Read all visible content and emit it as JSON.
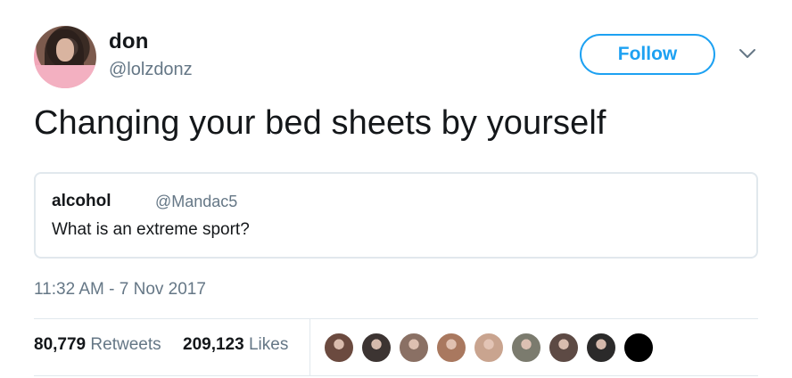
{
  "author": {
    "display_name": "don",
    "handle": "@lolzdonz",
    "avatar_icon": "profile-photo-avatar"
  },
  "follow": {
    "label": "Follow",
    "color": "#1da1f2"
  },
  "menu_icon": "chevron-down-icon",
  "tweet": {
    "text": "Changing your bed sheets by yourself"
  },
  "quoted_tweet": {
    "display_name": "alcohol",
    "handle": "@Mandac5",
    "text": "What is an extreme sport?"
  },
  "timestamp": "11:32 AM - 7 Nov 2017",
  "stats": {
    "retweets": {
      "count": "80,779",
      "label": "Retweets"
    },
    "likes": {
      "count": "209,123",
      "label": "Likes"
    }
  },
  "likers": [
    {
      "name": "liker-avatar-1",
      "color": "#6b4a3f"
    },
    {
      "name": "liker-avatar-2",
      "color": "#3c3432"
    },
    {
      "name": "liker-avatar-3",
      "color": "#8a7064"
    },
    {
      "name": "liker-avatar-4",
      "color": "#a9785f"
    },
    {
      "name": "liker-avatar-5",
      "color": "#c9a48f"
    },
    {
      "name": "liker-avatar-6",
      "color": "#7b7b6e"
    },
    {
      "name": "liker-avatar-7",
      "color": "#5d4a44"
    },
    {
      "name": "liker-avatar-8",
      "color": "#2b2a2a"
    },
    {
      "name": "liker-avatar-9",
      "color": "#000000"
    }
  ],
  "colors": {
    "text_primary": "#14171a",
    "text_secondary": "#657786",
    "border": "#e1e8ed"
  }
}
